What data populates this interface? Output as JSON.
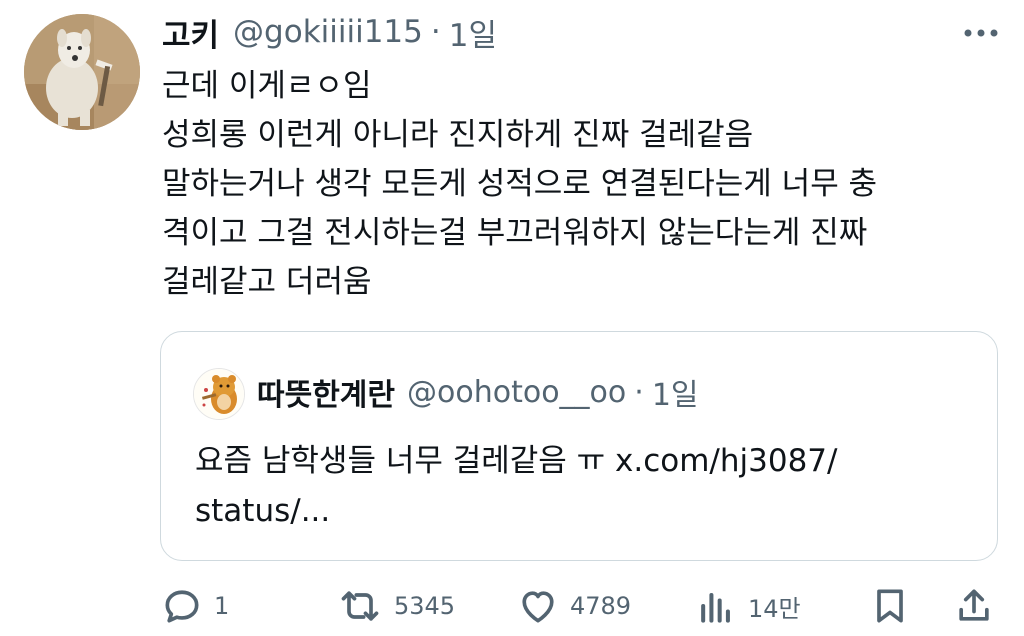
{
  "tweet": {
    "author_name": "고키",
    "handle": "@gokiiiii115",
    "separator": "·",
    "time": "1일",
    "lines": [
      "근데 이게ㄹㅇ임",
      "성희롱 이런게 아니라 진지하게 진짜 걸레같음",
      "말하는거나 생각 모든게 성적으로 연결된다는게 너무 충",
      "격이고 그걸 전시하는걸 부끄러워하지 않는다는게 진짜",
      "걸레같고 더러움"
    ]
  },
  "quoted": {
    "author_name": "따뜻한계란",
    "handle": "@oohotoo__oo",
    "separator": "·",
    "time": "1일",
    "lines": [
      "요즘 남학생들 너무 걸레같음 ㅠ x.com/hj3087/",
      "status/..."
    ]
  },
  "actions": {
    "replies": "1",
    "retweets": "5345",
    "likes": "4789",
    "views": "14만"
  },
  "icons": {
    "more": "more-icon",
    "reply": "reply-icon",
    "retweet": "retweet-icon",
    "like": "heart-icon",
    "views": "views-icon",
    "bookmark": "bookmark-icon",
    "share": "share-icon"
  },
  "colors": {
    "text": "#0f1419",
    "secondary": "#536471",
    "border": "#cfd9de"
  }
}
